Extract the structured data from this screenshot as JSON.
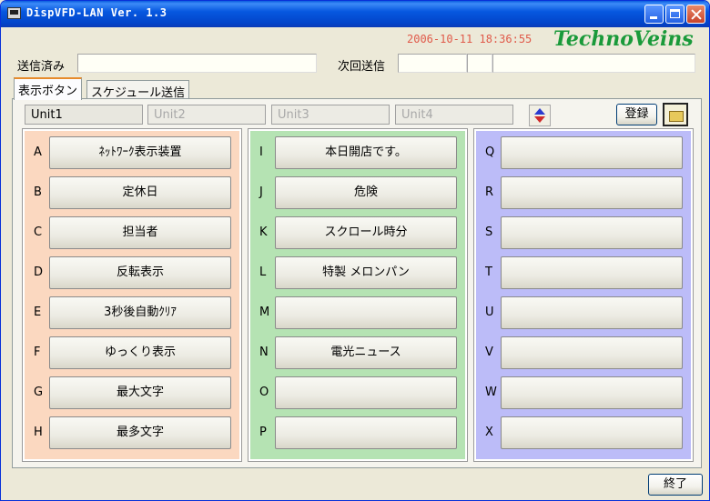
{
  "window": {
    "title": "DispVFD-LAN Ver. 1.3"
  },
  "header": {
    "datetime": "2006-10-11  18:36:55",
    "logo": "TechnoVeins"
  },
  "status": {
    "sent_label": "送信済み",
    "sent_value": "",
    "next_label": "次回送信",
    "next_values": [
      "",
      "",
      ""
    ]
  },
  "tabs": [
    {
      "label": "表示ボタン",
      "active": true
    },
    {
      "label": "スケジュール送信",
      "active": false
    }
  ],
  "units": [
    {
      "label": "Unit1",
      "active": true
    },
    {
      "label": "Unit2",
      "active": false
    },
    {
      "label": "Unit3",
      "active": false
    },
    {
      "label": "Unit4",
      "active": false
    }
  ],
  "toolbar": {
    "save_label": "登録",
    "folder_icon": "folder-icon",
    "reorder_icon": "up-down-arrows-icon"
  },
  "colors": {
    "col1": "#fbd8c0",
    "col2": "#b5e3b3",
    "col3": "#bcbcf8",
    "datetime": "#e05a4a",
    "logo": "#1a9a3a"
  },
  "columns": [
    {
      "rows": [
        {
          "letter": "A",
          "label": "ﾈｯﾄﾜｰｸ表示装置"
        },
        {
          "letter": "B",
          "label": "定休日"
        },
        {
          "letter": "C",
          "label": "担当者"
        },
        {
          "letter": "D",
          "label": "反転表示"
        },
        {
          "letter": "E",
          "label": "3秒後自動ｸﾘｱ"
        },
        {
          "letter": "F",
          "label": "ゆっくり表示"
        },
        {
          "letter": "G",
          "label": "最大文字"
        },
        {
          "letter": "H",
          "label": "最多文字"
        }
      ]
    },
    {
      "rows": [
        {
          "letter": "I",
          "label": "本日開店です。"
        },
        {
          "letter": "J",
          "label": "危険"
        },
        {
          "letter": "K",
          "label": "スクロール時分"
        },
        {
          "letter": "L",
          "label": "特製 メロンパン"
        },
        {
          "letter": "M",
          "label": ""
        },
        {
          "letter": "N",
          "label": "電光ニュース"
        },
        {
          "letter": "O",
          "label": ""
        },
        {
          "letter": "P",
          "label": ""
        }
      ]
    },
    {
      "rows": [
        {
          "letter": "Q",
          "label": ""
        },
        {
          "letter": "R",
          "label": ""
        },
        {
          "letter": "S",
          "label": ""
        },
        {
          "letter": "T",
          "label": ""
        },
        {
          "letter": "U",
          "label": ""
        },
        {
          "letter": "V",
          "label": ""
        },
        {
          "letter": "W",
          "label": ""
        },
        {
          "letter": "X",
          "label": ""
        }
      ]
    }
  ],
  "footer": {
    "close_label": "終了"
  }
}
